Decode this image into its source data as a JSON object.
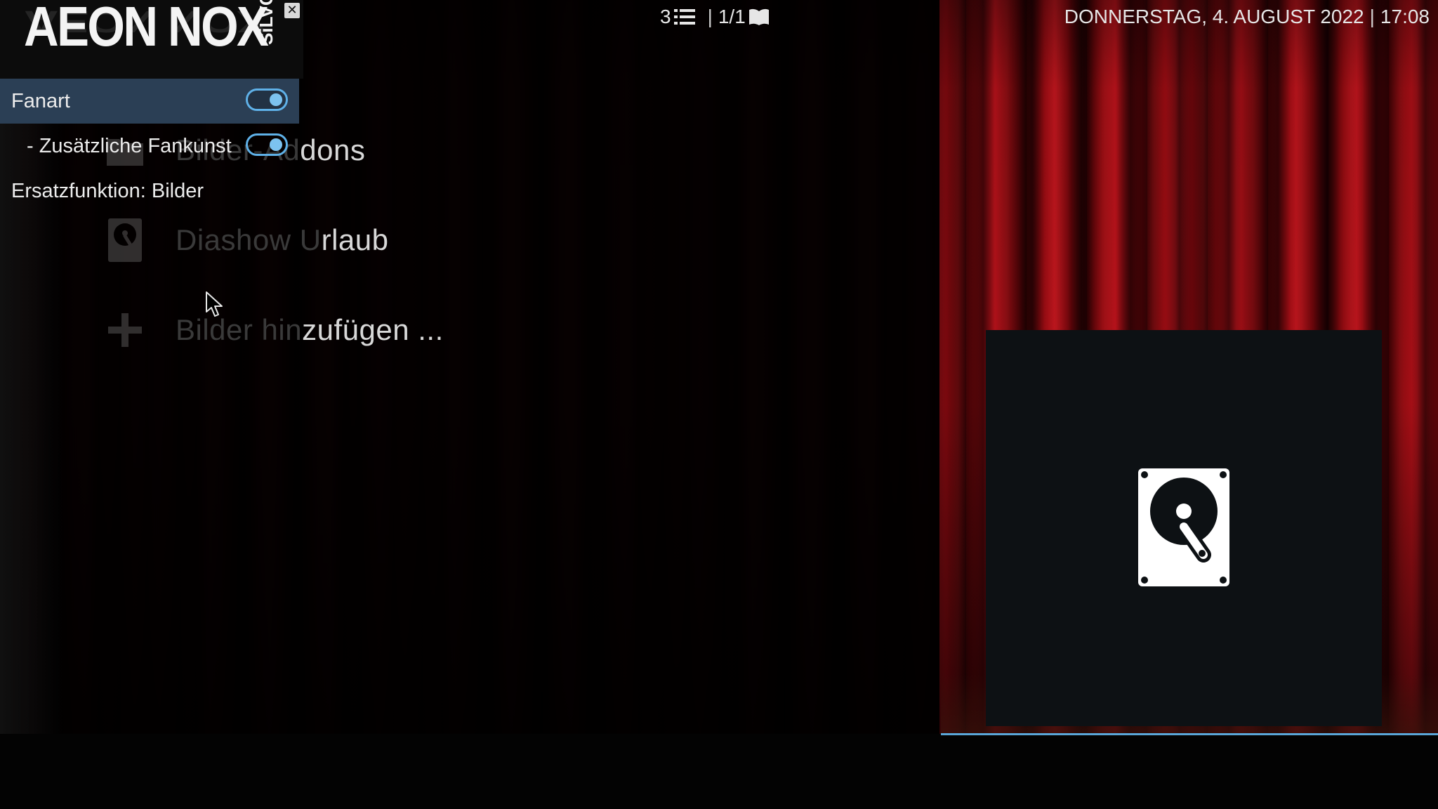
{
  "topbar": {
    "logo_text": "AEON NOX",
    "logo_sub": "SiLVO",
    "close_glyph": "✕",
    "item_count": "3",
    "page_info": "1/1",
    "separator": "|",
    "date": "DONNERSTAG, 4. AUGUST 2022",
    "time": "17:08",
    "list_icon": "list-icon",
    "book_icon": "book-icon"
  },
  "settings_panel": {
    "rows": [
      {
        "label": "Fanart",
        "toggle": true,
        "selected": true
      },
      {
        "label": "- Zusätzliche Fankunst",
        "toggle": true,
        "selected": false
      },
      {
        "label": "Ersatzfunktion: Bilder",
        "toggle": null,
        "selected": false
      }
    ]
  },
  "list": {
    "items": [
      {
        "label_hidden": "Bilder-Ad",
        "label_visible": "dons",
        "icon": "folder-icon"
      },
      {
        "label_hidden": "Diashow U",
        "label_visible": "rlaub",
        "icon": "hard-drive-icon"
      },
      {
        "label_hidden": "Bilder hin",
        "label_visible": "zufügen ...",
        "icon": "plus-icon"
      }
    ]
  },
  "preview": {
    "icon": "hard-drive-icon"
  },
  "colors": {
    "accent": "#5fb1e8",
    "selected_row": "#2b3f55",
    "curtain": "#8e0a10"
  }
}
